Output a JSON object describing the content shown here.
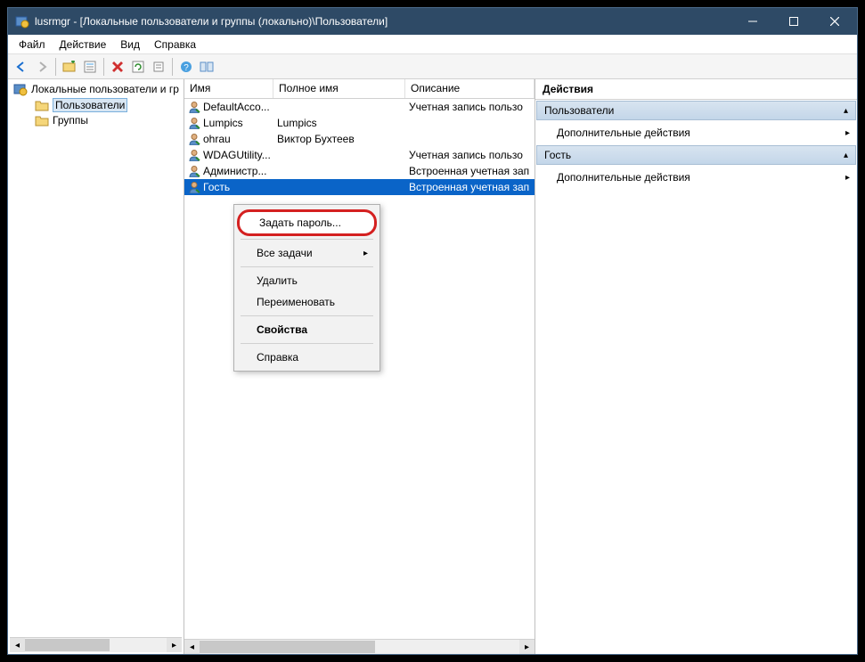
{
  "titlebar": {
    "title": "lusrmgr - [Локальные пользователи и группы (локально)\\Пользователи]"
  },
  "menubar": {
    "file": "Файл",
    "action": "Действие",
    "view": "Вид",
    "help": "Справка"
  },
  "tree": {
    "root": "Локальные пользователи и гр",
    "users": "Пользователи",
    "groups": "Группы"
  },
  "list": {
    "columns": {
      "name": "Имя",
      "fullname": "Полное имя",
      "description": "Описание"
    },
    "rows": [
      {
        "name": "DefaultAcco...",
        "fullname": "",
        "description": "Учетная запись пользо"
      },
      {
        "name": "Lumpics",
        "fullname": "Lumpics",
        "description": ""
      },
      {
        "name": "ohrau",
        "fullname": "Виктор Бухтеев",
        "description": ""
      },
      {
        "name": "WDAGUtility...",
        "fullname": "",
        "description": "Учетная запись пользо"
      },
      {
        "name": "Администр...",
        "fullname": "",
        "description": "Встроенная учетная зап"
      },
      {
        "name": "Гость",
        "fullname": "",
        "description": "Встроенная учетная зап"
      }
    ]
  },
  "context_menu": {
    "set_password": "Задать пароль...",
    "all_tasks": "Все задачи",
    "delete": "Удалить",
    "rename": "Переименовать",
    "properties": "Свойства",
    "help": "Справка"
  },
  "actions": {
    "title": "Действия",
    "group1": "Пользователи",
    "more1": "Дополнительные действия",
    "group2": "Гость",
    "more2": "Дополнительные действия"
  }
}
